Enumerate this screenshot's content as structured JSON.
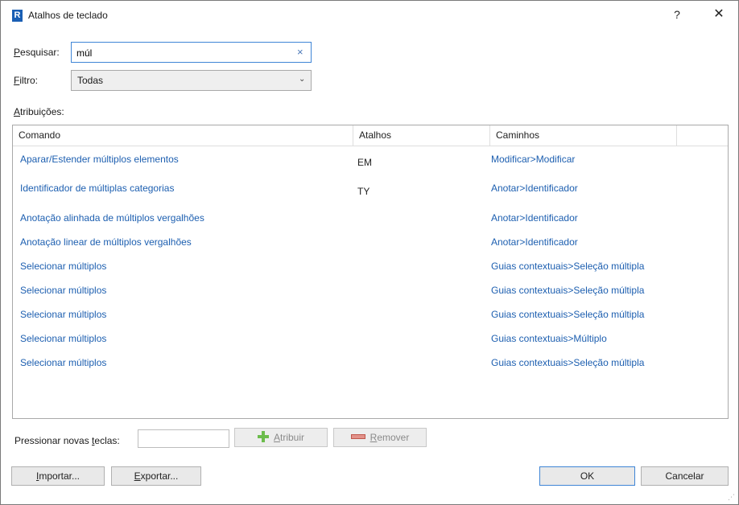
{
  "window": {
    "app_icon_letter": "R",
    "title": "Atalhos de teclado",
    "help_label": "?",
    "close_label": "✕"
  },
  "search": {
    "label_accel": "P",
    "label_rest": "esquisar:",
    "value": "múl",
    "clear_label": "×"
  },
  "filter": {
    "label_accel": "F",
    "label_rest": "iltro:",
    "selected": "Todas",
    "chevron": "⌄"
  },
  "assignments": {
    "label_accel": "A",
    "label_rest": "tribuições:"
  },
  "table": {
    "headers": {
      "command": "Comando",
      "shortcuts": "Atalhos",
      "paths": "Caminhos"
    },
    "rows": [
      {
        "command": "Aparar/Estender múltiplos elementos",
        "shortcut": "EM",
        "path": "Modificar>Modificar"
      },
      {
        "command": "Identificador de múltiplas categorias",
        "shortcut": "TY",
        "path": "Anotar>Identificador"
      },
      {
        "command": "Anotação alinhada de múltiplos vergalhões",
        "shortcut": "",
        "path": "Anotar>Identificador"
      },
      {
        "command": "Anotação linear de múltiplos vergalhões",
        "shortcut": "",
        "path": "Anotar>Identificador"
      },
      {
        "command": "Selecionar múltiplos",
        "shortcut": "",
        "path": "Guias contextuais>Seleção múltipla"
      },
      {
        "command": "Selecionar múltiplos",
        "shortcut": "",
        "path": "Guias contextuais>Seleção múltipla"
      },
      {
        "command": "Selecionar múltiplos",
        "shortcut": "",
        "path": "Guias contextuais>Seleção múltipla"
      },
      {
        "command": "Selecionar múltiplos",
        "shortcut": "",
        "path": "Guias contextuais>Múltiplo"
      },
      {
        "command": "Selecionar múltiplos",
        "shortcut": "",
        "path": "Guias contextuais>Seleção múltipla"
      }
    ]
  },
  "keys": {
    "label_pre": "Pressionar novas ",
    "label_accel": "t",
    "label_post": "eclas:",
    "value": ""
  },
  "buttons": {
    "assign_accel": "A",
    "assign_rest": "tribuir",
    "remove_accel": "R",
    "remove_rest": "emover",
    "import_accel": "I",
    "import_rest": "mportar...",
    "export_accel": "E",
    "export_rest": "xportar...",
    "ok": "OK",
    "cancel": "Cancelar"
  },
  "colors": {
    "link_text": "#1d5fb0",
    "focus_border": "#3f85d6",
    "assign_icon": "#6cbc4c",
    "remove_icon": "#e2928a"
  }
}
